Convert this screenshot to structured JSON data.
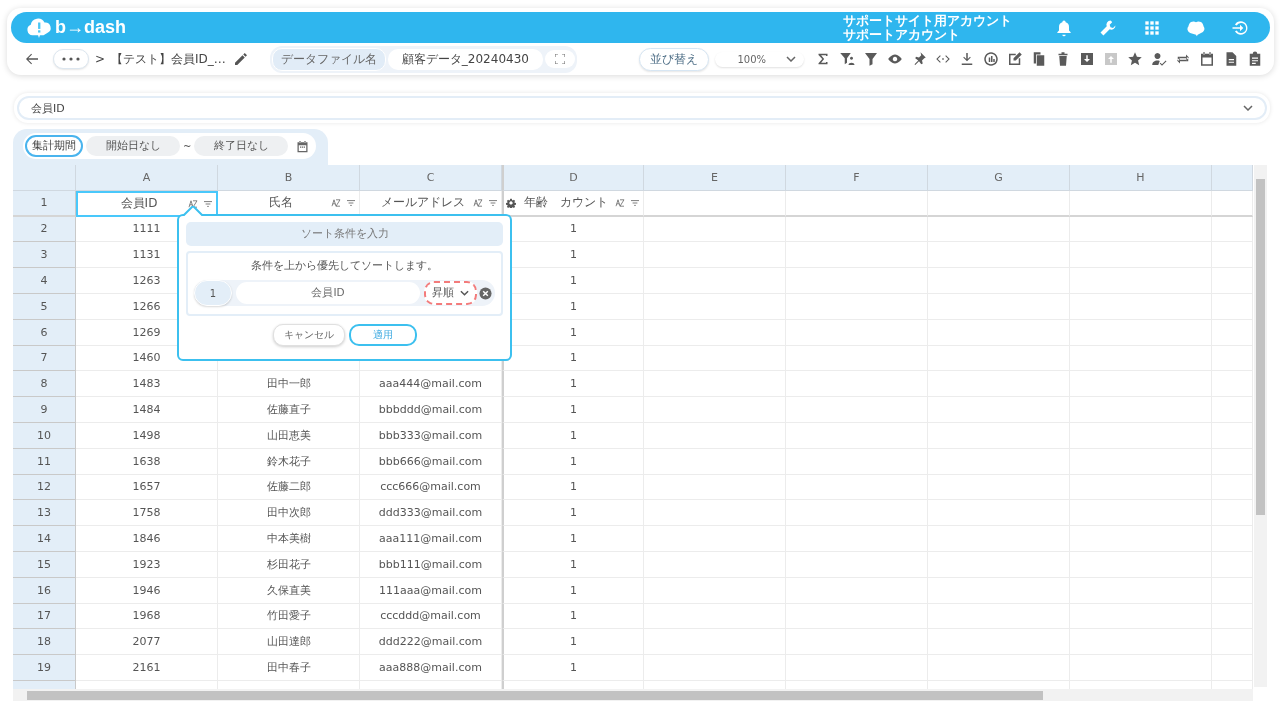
{
  "header": {
    "logo_text": "b→dash",
    "account_lines": [
      "サポートサイト用アカウント",
      "サポートアカウント"
    ]
  },
  "toolbar": {
    "breadcrumb": "【テスト】会員ID_…",
    "breadcrumb_sep": ">",
    "file_label": "データファイル名",
    "file_name": "顧客データ_20240430",
    "sort_button": "並び替え",
    "zoom": "100%"
  },
  "field_select": {
    "value": "会員ID"
  },
  "date_filter": {
    "label": "集計期間",
    "start": "開始日なし",
    "separator": "~",
    "end": "終了日なし"
  },
  "sheet": {
    "column_letters": [
      "A",
      "B",
      "C",
      "D",
      "E",
      "F",
      "G",
      "H"
    ],
    "header_row": {
      "num": "1",
      "cells": [
        {
          "text": "会員ID",
          "selected": true
        },
        {
          "text": "氏名",
          "selected": false
        },
        {
          "text": "メールアドレス",
          "selected": false
        },
        {
          "text": "年齢　カウント",
          "selected": false
        }
      ]
    },
    "rows": [
      {
        "num": "2",
        "id": "1111",
        "count": "1"
      },
      {
        "num": "3",
        "id": "1131",
        "count": "1"
      },
      {
        "num": "4",
        "id": "1263",
        "count": "1"
      },
      {
        "num": "5",
        "id": "1266",
        "count": "1"
      },
      {
        "num": "6",
        "id": "1269",
        "count": "1"
      },
      {
        "num": "7",
        "id": "1460",
        "count": "1"
      },
      {
        "num": "8",
        "id": "1483",
        "name": "田中一郎",
        "email": "aaa444@mail.com",
        "count": "1"
      },
      {
        "num": "9",
        "id": "1484",
        "name": "佐藤直子",
        "email": "bbbddd@mail.com",
        "count": "1"
      },
      {
        "num": "10",
        "id": "1498",
        "name": "山田恵美",
        "email": "bbb333@mail.com",
        "count": "1"
      },
      {
        "num": "11",
        "id": "1638",
        "name": "鈴木花子",
        "email": "bbb666@mail.com",
        "count": "1"
      },
      {
        "num": "12",
        "id": "1657",
        "name": "佐藤二郎",
        "email": "ccc666@mail.com",
        "count": "1"
      },
      {
        "num": "13",
        "id": "1758",
        "name": "田中次郎",
        "email": "ddd333@mail.com",
        "count": "1"
      },
      {
        "num": "14",
        "id": "1846",
        "name": "中本美樹",
        "email": "aaa111@mail.com",
        "count": "1"
      },
      {
        "num": "15",
        "id": "1923",
        "name": "杉田花子",
        "email": "bbb111@mail.com",
        "count": "1"
      },
      {
        "num": "16",
        "id": "1946",
        "name": "久保直美",
        "email": "111aaa@mail.com",
        "count": "1"
      },
      {
        "num": "17",
        "id": "1968",
        "name": "竹田愛子",
        "email": "cccddd@mail.com",
        "count": "1"
      },
      {
        "num": "18",
        "id": "2077",
        "name": "山田達郎",
        "email": "ddd222@mail.com",
        "count": "1"
      },
      {
        "num": "19",
        "id": "2161",
        "name": "田中春子",
        "email": "aaa888@mail.com",
        "count": "1"
      }
    ]
  },
  "sort_dialog": {
    "title": "ソート条件を入力",
    "description": "条件を上から優先してソートします。",
    "conditions": [
      {
        "num": "1",
        "field": "会員ID",
        "order": "昇順",
        "highlighted": true
      }
    ],
    "cancel": "キャンセル",
    "apply": "適用"
  }
}
